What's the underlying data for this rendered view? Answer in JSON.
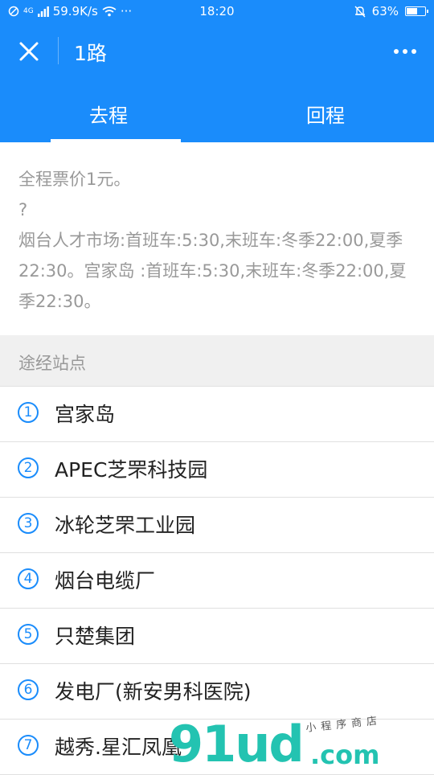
{
  "status_bar": {
    "network": "4G",
    "speed": "59.9K/s",
    "dots": "···",
    "time": "18:20",
    "battery_percent": "63%",
    "battery_level": 0.63
  },
  "nav": {
    "title": "1路"
  },
  "tabs": [
    {
      "label": "去程",
      "active": true
    },
    {
      "label": "回程",
      "active": false
    }
  ],
  "info": {
    "lines": [
      "全程票价1元。",
      "?",
      "烟台人才市场:首班车:5:30,末班车:冬季22:00,夏季22:30。宫家岛 :首班车:5:30,末班车:冬季22:00,夏季22:30。"
    ]
  },
  "stops_header": "途经站点",
  "stops": [
    {
      "num": "1",
      "name": "宫家岛"
    },
    {
      "num": "2",
      "name": "APEC芝罘科技园"
    },
    {
      "num": "3",
      "name": "冰轮芝罘工业园"
    },
    {
      "num": "4",
      "name": "烟台电缆厂"
    },
    {
      "num": "5",
      "name": "只楚集团"
    },
    {
      "num": "6",
      "name": "发电厂(新安男科医院)"
    },
    {
      "num": "7",
      "name": "越秀.星汇凤凰"
    }
  ],
  "watermark": {
    "big": "91ud",
    "com": ".com",
    "small": "小程序商店"
  },
  "colors": {
    "primary": "#1a8cfb",
    "watermark": "#23c3b1"
  }
}
